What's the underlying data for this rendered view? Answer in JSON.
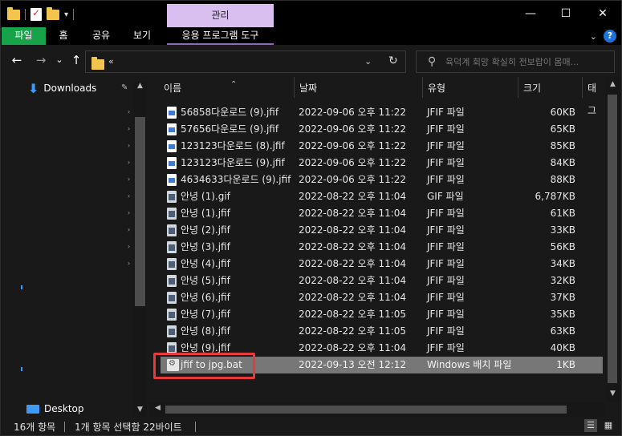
{
  "titlebar": {
    "manage_tab": "관리",
    "controls": {
      "minimize": "—",
      "maximize": "☐",
      "close": "✕"
    }
  },
  "ribbon": {
    "tabs": [
      "파일",
      "홈",
      "공유",
      "보기"
    ],
    "context_tab": "응용 프로그램 도구",
    "help": "?"
  },
  "nav": {
    "back": "←",
    "forward": "→",
    "recent": "⌄",
    "up": "↑",
    "address_crumb": "«",
    "address_dropdown": "⌄",
    "refresh": "↻"
  },
  "search": {
    "placeholder": "육덕계 회망 확실히 전보랍이 몸매..."
  },
  "navpane": {
    "quick_access_item": "Downloads",
    "desktop_item": "Desktop"
  },
  "columns": {
    "name": "이름",
    "date": "날짜",
    "type": "유형",
    "size": "크기",
    "tags": "태그"
  },
  "files": [
    {
      "name": "56858다운로드 (9).jfif",
      "date": "2022-09-06 오후 11:22",
      "type": "JFIF 파일",
      "size": "60KB",
      "icon": "jfif-icon"
    },
    {
      "name": "57656다운로드 (9).jfif",
      "date": "2022-09-06 오후 11:22",
      "type": "JFIF 파일",
      "size": "65KB",
      "icon": "jfif-icon"
    },
    {
      "name": "123123다운로드 (8).jfif",
      "date": "2022-09-06 오후 11:22",
      "type": "JFIF 파일",
      "size": "85KB",
      "icon": "jfif-icon"
    },
    {
      "name": "123123다운로드 (9).jfif",
      "date": "2022-09-06 오후 11:22",
      "type": "JFIF 파일",
      "size": "84KB",
      "icon": "jfif-icon"
    },
    {
      "name": "4634633다운로드 (9).jfif",
      "date": "2022-09-06 오후 11:22",
      "type": "JFIF 파일",
      "size": "88KB",
      "icon": "jfif-icon"
    },
    {
      "name": "안녕 (1).gif",
      "date": "2022-08-22 오후 11:04",
      "type": "GIF 파일",
      "size": "6,787KB",
      "icon": "gif-icon"
    },
    {
      "name": "안녕 (1).jfif",
      "date": "2022-08-22 오후 11:04",
      "type": "JFIF 파일",
      "size": "61KB",
      "icon": "gif-icon"
    },
    {
      "name": "안녕 (2).jfif",
      "date": "2022-08-22 오후 11:04",
      "type": "JFIF 파일",
      "size": "33KB",
      "icon": "gif-icon"
    },
    {
      "name": "안녕 (3).jfif",
      "date": "2022-08-22 오후 11:04",
      "type": "JFIF 파일",
      "size": "56KB",
      "icon": "gif-icon"
    },
    {
      "name": "안녕 (4).jfif",
      "date": "2022-08-22 오후 11:04",
      "type": "JFIF 파일",
      "size": "34KB",
      "icon": "gif-icon"
    },
    {
      "name": "안녕 (5).jfif",
      "date": "2022-08-22 오후 11:04",
      "type": "JFIF 파일",
      "size": "32KB",
      "icon": "gif-icon"
    },
    {
      "name": "안녕 (6).jfif",
      "date": "2022-08-22 오후 11:04",
      "type": "JFIF 파일",
      "size": "37KB",
      "icon": "gif-icon"
    },
    {
      "name": "안녕 (7).jfif",
      "date": "2022-08-22 오후 11:05",
      "type": "JFIF 파일",
      "size": "35KB",
      "icon": "gif-icon"
    },
    {
      "name": "안녕 (8).jfif",
      "date": "2022-08-22 오후 11:05",
      "type": "JFIF 파일",
      "size": "63KB",
      "icon": "gif-icon"
    },
    {
      "name": "안녕 (9).jfif",
      "date": "2022-08-22 오후 11:04",
      "type": "JFIF 파일",
      "size": "40KB",
      "icon": "gif-icon"
    },
    {
      "name": "jfif to jpg.bat",
      "date": "2022-09-13 오전 12:12",
      "type": "Windows 배치 파일",
      "size": "1KB",
      "icon": "batch-file-icon",
      "selected": true
    }
  ],
  "status": {
    "item_count": "16개 항목",
    "selection": "1개 항목 선택함 22바이트"
  },
  "colors": {
    "file_tab": "#16a34a",
    "manage_tab": "#d9bff0",
    "selection": "#777777",
    "highlight_box": "#e63b3b",
    "accent_blue": "#3e9af6"
  }
}
